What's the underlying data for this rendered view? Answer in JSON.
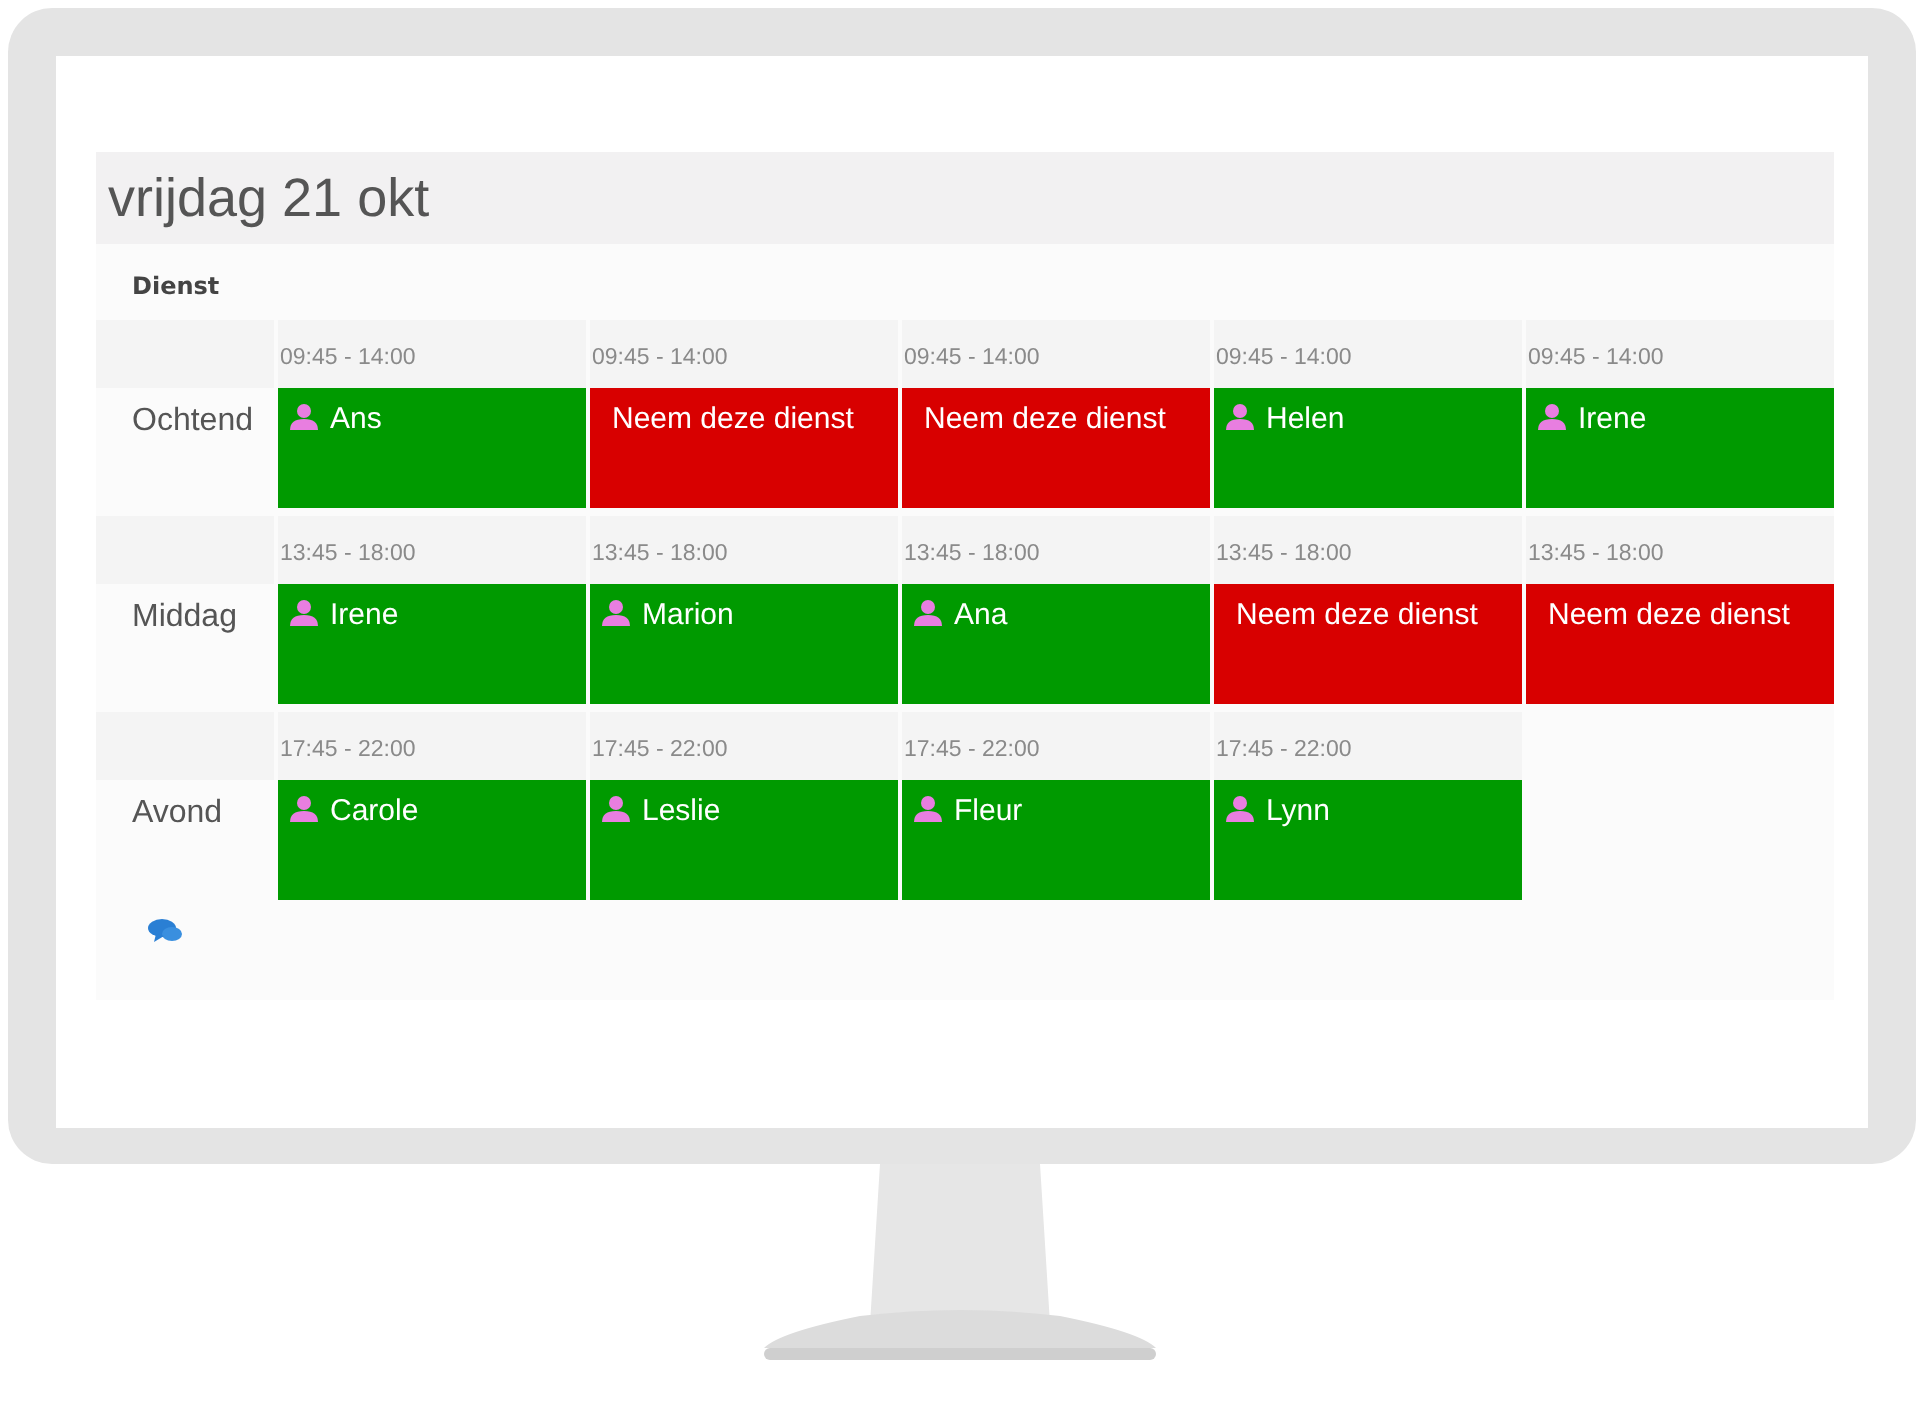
{
  "title": "vrijdag 21 okt",
  "section_label": "Dienst",
  "shifts": [
    {
      "label": "Ochtend",
      "slots": [
        {
          "time": "09:45 - 14:00",
          "kind": "taken",
          "text": "Ans"
        },
        {
          "time": "09:45 - 14:00",
          "kind": "open",
          "text": "Neem deze dienst"
        },
        {
          "time": "09:45 - 14:00",
          "kind": "open",
          "text": "Neem deze dienst"
        },
        {
          "time": "09:45 - 14:00",
          "kind": "taken",
          "text": "Helen"
        },
        {
          "time": "09:45 - 14:00",
          "kind": "taken",
          "text": "Irene"
        }
      ]
    },
    {
      "label": "Middag",
      "slots": [
        {
          "time": "13:45 - 18:00",
          "kind": "taken",
          "text": "Irene"
        },
        {
          "time": "13:45 - 18:00",
          "kind": "taken",
          "text": "Marion"
        },
        {
          "time": "13:45 - 18:00",
          "kind": "taken",
          "text": "Ana"
        },
        {
          "time": "13:45 - 18:00",
          "kind": "open",
          "text": "Neem deze dienst"
        },
        {
          "time": "13:45 - 18:00",
          "kind": "open",
          "text": "Neem deze dienst"
        }
      ]
    },
    {
      "label": "Avond",
      "slots": [
        {
          "time": "17:45 - 22:00",
          "kind": "taken",
          "text": "Carole"
        },
        {
          "time": "17:45 - 22:00",
          "kind": "taken",
          "text": "Leslie"
        },
        {
          "time": "17:45 - 22:00",
          "kind": "taken",
          "text": "Fleur"
        },
        {
          "time": "17:45 - 22:00",
          "kind": "taken",
          "text": "Lynn"
        }
      ]
    }
  ]
}
